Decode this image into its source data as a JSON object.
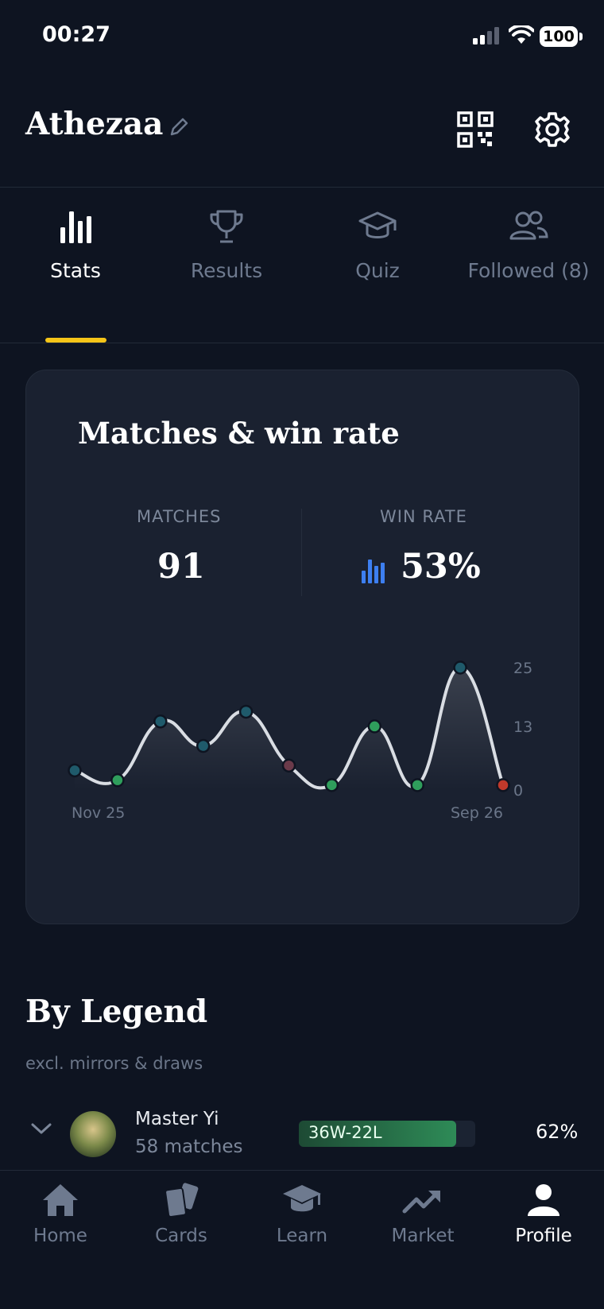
{
  "status_bar": {
    "time": "00:27",
    "battery": "100"
  },
  "header": {
    "username": "Athezaa"
  },
  "tabs": [
    {
      "label": "Stats",
      "icon": "bar-chart-icon",
      "active": true
    },
    {
      "label": "Results",
      "icon": "trophy-icon",
      "active": false
    },
    {
      "label": "Quiz",
      "icon": "graduation-cap-icon",
      "active": false
    },
    {
      "label": "Followed (8)",
      "icon": "users-icon",
      "active": false
    }
  ],
  "stats_card": {
    "title": "Matches & win rate",
    "matches_label": "MATCHES",
    "matches_value": "91",
    "winrate_label": "WIN RATE",
    "winrate_value": "53%"
  },
  "chart_data": {
    "type": "line",
    "x_labels": [
      "Nov 25",
      "Sep 26"
    ],
    "y_ticks": [
      "25",
      "13",
      "0"
    ],
    "ylim": [
      0,
      25
    ],
    "values": [
      4,
      2,
      14,
      9,
      16,
      5,
      1,
      13,
      1,
      25,
      1
    ],
    "point_colors": [
      "#1f5a6b",
      "#2f9e5c",
      "#1f5a6b",
      "#1f5a6b",
      "#1f5a6b",
      "#6b3a4a",
      "#2f9e5c",
      "#2f9e5c",
      "#2f9e5c",
      "#1f5a6b",
      "#c0392b"
    ],
    "line_color": "#d9dde3",
    "grid": false
  },
  "by_legend": {
    "title": "By Legend",
    "subtitle": "excl. mirrors & draws",
    "rows": [
      {
        "name": "Master Yi",
        "matches": "58 matches",
        "record": "36W-22L",
        "win_fraction": 0.62,
        "pct": "62%"
      }
    ]
  },
  "bottom_nav": [
    {
      "label": "Home",
      "icon": "home-icon",
      "active": false
    },
    {
      "label": "Cards",
      "icon": "cards-icon",
      "active": false
    },
    {
      "label": "Learn",
      "icon": "graduation-cap-icon",
      "active": false
    },
    {
      "label": "Market",
      "icon": "trending-up-icon",
      "active": false
    },
    {
      "label": "Profile",
      "icon": "user-icon",
      "active": true
    }
  ],
  "colors": {
    "background": "#0e1421",
    "card": "#1a2130",
    "accent": "#f5c518",
    "win_green": "#2e8b57",
    "loss_red": "#c0392b"
  }
}
